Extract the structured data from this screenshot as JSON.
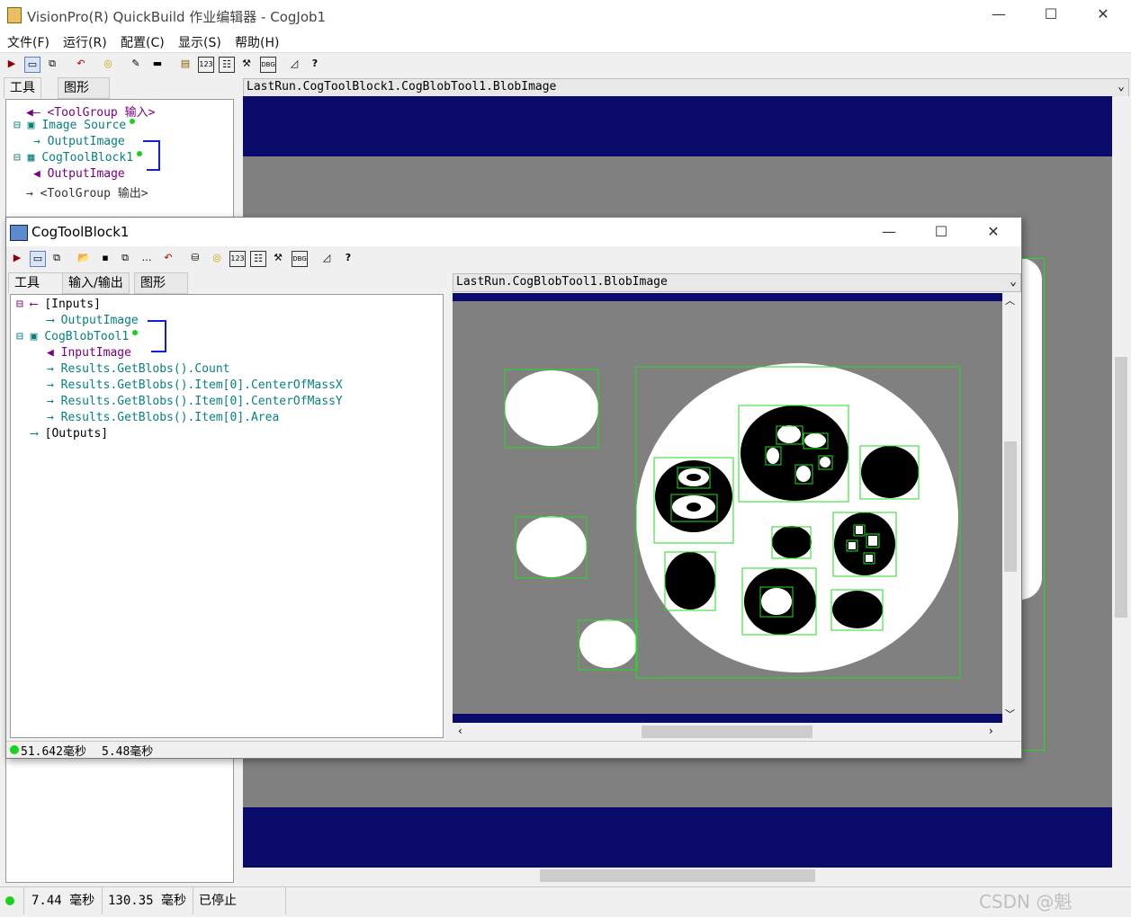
{
  "main_window": {
    "title": "VisionPro(R) QuickBuild 作业编辑器 - CogJob1",
    "controls": {
      "minimize": "—",
      "maximize": "☐",
      "close": "✕"
    },
    "menu": [
      "文件(F)",
      "运行(R)",
      "配置(C)",
      "显示(S)",
      "帮助(H)"
    ],
    "tabs": [
      "工具",
      "图形"
    ],
    "tree": {
      "input": "<ToolGroup 输入>",
      "image_source": "Image Source",
      "output_image_1": "OutputImage",
      "toolblock": "CogToolBlock1",
      "output_image_2": "OutputImage",
      "output": "<ToolGroup 输出>"
    },
    "display_path": "LastRun.CogToolBlock1.CogBlobTool1.BlobImage",
    "status": {
      "time1": "7.44 毫秒",
      "time2": "130.35 毫秒",
      "state": "已停止"
    }
  },
  "child_window": {
    "title": "CogToolBlock1",
    "controls": {
      "minimize": "—",
      "maximize": "☐",
      "close": "✕"
    },
    "tabs": [
      "工具",
      "输入/输出",
      "图形"
    ],
    "tree": {
      "inputs": "[Inputs]",
      "output_image": "OutputImage",
      "blob_tool": "CogBlobTool1",
      "input_image": "InputImage",
      "results": [
        "Results.GetBlobs().Count",
        "Results.GetBlobs().Item[0].CenterOfMassX",
        "Results.GetBlobs().Item[0].CenterOfMassY",
        "Results.GetBlobs().Item[0].Area"
      ],
      "outputs": "[Outputs]"
    },
    "display_path": "LastRun.CogBlobTool1.BlobImage",
    "status": {
      "time1": "51.642毫秒",
      "time2": "5.48毫秒"
    }
  },
  "watermark": "CSDN @魁",
  "colors": {
    "navy_band": "#0b0b6b",
    "image_gray": "#808080",
    "blob_outline": "#22dd22",
    "teal_text": "#0a7f7f",
    "purple_text": "#7a0080"
  },
  "toolbar_icons": [
    "run-icon",
    "display-icon",
    "tool-icon",
    "reset-icon",
    "live-icon",
    "edit-icon",
    "stop-icon",
    "notepad-icon",
    "number-icon",
    "grid-icon",
    "tools-icon",
    "dbg-icon",
    "chart-icon",
    "help-icon"
  ]
}
